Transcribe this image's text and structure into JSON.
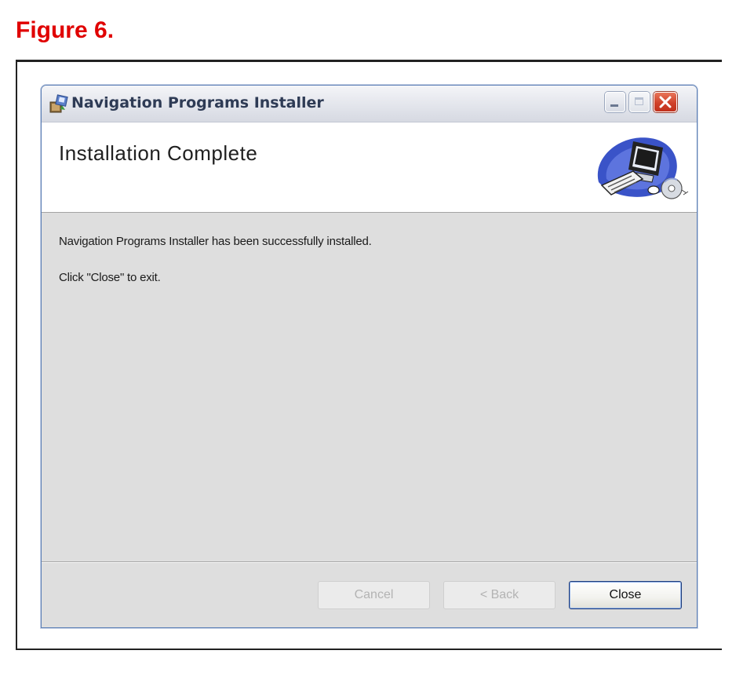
{
  "figure_caption": "Figure 6.",
  "window": {
    "title": "Navigation Programs Installer",
    "controls": {
      "minimize_icon": "minimize-icon",
      "maximize_icon": "maximize-icon",
      "close_icon": "close-icon"
    },
    "app_icon": "installer-icon"
  },
  "header": {
    "title": "Installation Complete",
    "art_icon": "computer-cd-icon"
  },
  "body": {
    "message": "Navigation Programs Installer has been successfully installed.",
    "instruction": "Click \"Close\" to exit."
  },
  "footer": {
    "cancel_label": "Cancel",
    "back_label": "< Back",
    "close_label": "Close"
  },
  "colors": {
    "caption": "#e00000",
    "body_background": "#dedede",
    "close_button_border": "#1e3c7a"
  }
}
